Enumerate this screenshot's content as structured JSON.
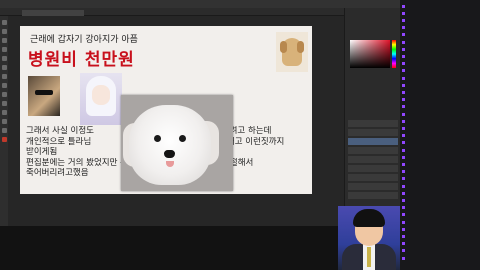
{
  "photoshop": {
    "menu": [
      "",
      "",
      "",
      "",
      "",
      "",
      "",
      "",
      "",
      "",
      ""
    ],
    "document_tab": "",
    "panels": {
      "tabs": [
        "",
        "",
        ""
      ]
    },
    "layers": [
      "",
      "",
      "",
      "",
      "",
      "",
      "",
      "",
      ""
    ]
  },
  "canvas": {
    "headline": "근래에 갑자기 강아지가 아픔",
    "big_title": "병원비 천만원",
    "body_lines": [
      "그래서 사실 이정도",
      "개인적으로 틀라님",
      "받이게됨",
      "편집분에는 거의 봤었지만 누이지닥스님이 거의 좋아서 혼절해서",
      "죽어버리려고했음"
    ],
    "body_right_fragments": [
      "찬하려고 하는데",
      "욕심내고 이런짓까지"
    ]
  },
  "chat": {
    "messages": [
      {
        "user": "",
        "color": "#ffffff",
        "text": ""
      },
      {
        "user": "",
        "color": "#f0d050",
        "text": ""
      },
      {
        "user": "",
        "color": "#88ccff",
        "text": ""
      },
      {
        "user": "",
        "color": "#f0d050",
        "text": ""
      },
      {
        "user": "",
        "color": "#7fe07f",
        "text": ""
      },
      {
        "user": "",
        "color": "#f0d050",
        "text": ""
      },
      {
        "user": "",
        "color": "#ff9966",
        "text": ""
      },
      {
        "user": "",
        "color": "#f0d050",
        "text": ""
      },
      {
        "user": "",
        "color": "#f0d050",
        "text": ""
      },
      {
        "user": "",
        "color": "#88ccff",
        "text": ""
      },
      {
        "user": "",
        "color": "#f0d050",
        "text": ""
      },
      {
        "user": "",
        "color": "#f0d050",
        "text": ""
      },
      {
        "user": "",
        "color": "#7fe07f",
        "text": ""
      },
      {
        "user": "",
        "color": "#f0d050",
        "text": ""
      },
      {
        "user": "",
        "color": "#f0d050",
        "text": ""
      },
      {
        "user": "",
        "color": "#ff9966",
        "text": ""
      },
      {
        "user": "",
        "color": "#f0d050",
        "text": ""
      },
      {
        "user": "",
        "color": "#f0d050",
        "text": ""
      },
      {
        "user": "",
        "color": "#88ccff",
        "text": ""
      },
      {
        "user": "",
        "color": "#f0d050",
        "text": ""
      },
      {
        "user": "",
        "color": "#f0d050",
        "text": ""
      },
      {
        "user": "",
        "color": "#7fe07f",
        "text": ""
      },
      {
        "user": "",
        "color": "#f0d050",
        "text": ""
      },
      {
        "user": "",
        "color": "#f0d050",
        "text": ""
      },
      {
        "user": "",
        "color": "#ff9966",
        "text": ""
      },
      {
        "user": "",
        "color": "#f0d050",
        "text": ""
      },
      {
        "user": "",
        "color": "#f0d050",
        "text": ""
      },
      {
        "user": "",
        "color": "#88ccff",
        "text": ""
      },
      {
        "user": "",
        "color": "#f0d050",
        "text": ""
      },
      {
        "user": "",
        "color": "#f0d050",
        "text": ""
      },
      {
        "user": "",
        "color": "#7fe07f",
        "text": ""
      },
      {
        "user": "",
        "color": "#f0d050",
        "text": ""
      },
      {
        "user": "",
        "color": "#f0d050",
        "text": ""
      },
      {
        "user": "",
        "color": "#f0d050",
        "text": ""
      },
      {
        "user": "",
        "color": "#f0d050",
        "text": ""
      },
      {
        "user": "",
        "color": "#88ccff",
        "text": ""
      }
    ]
  },
  "colors": {
    "title_red": "#c8101c",
    "canvas_bg": "#f2efec",
    "ps_dark": "#2b2b2b",
    "chat_bg": "#18181b"
  }
}
